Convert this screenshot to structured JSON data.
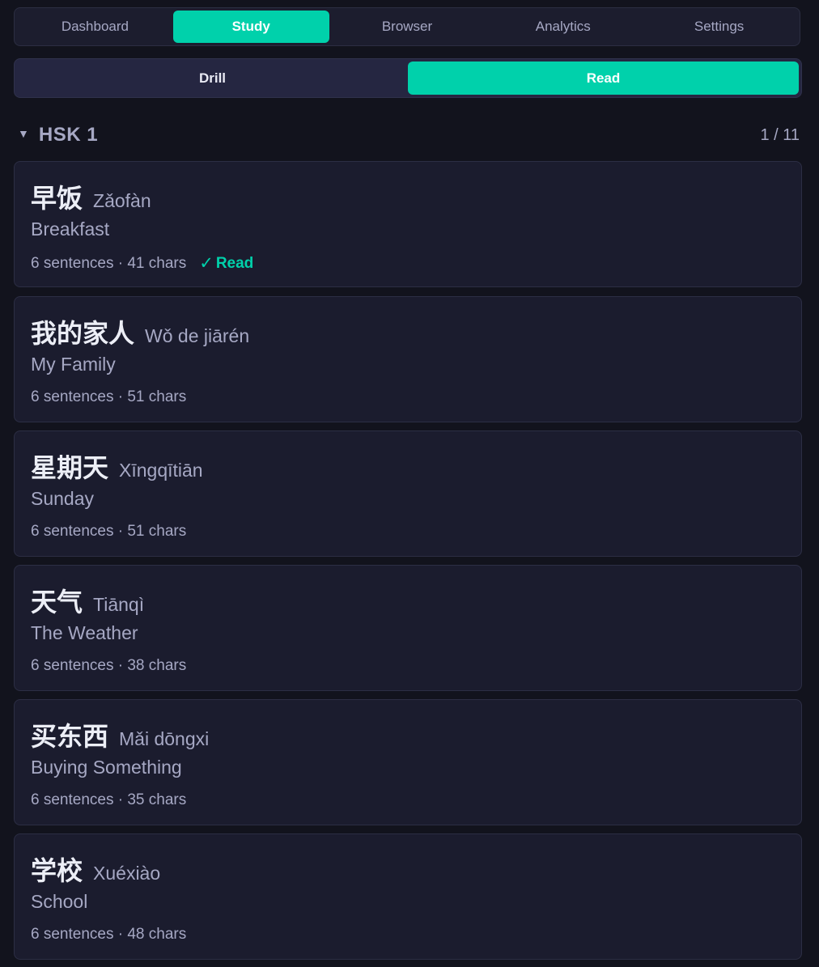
{
  "nav": {
    "tabs": [
      {
        "label": "Dashboard"
      },
      {
        "label": "Study"
      },
      {
        "label": "Browser"
      },
      {
        "label": "Analytics"
      },
      {
        "label": "Settings"
      }
    ],
    "active_tab": "Study"
  },
  "mode": {
    "tabs": [
      {
        "label": "Drill"
      },
      {
        "label": "Read"
      }
    ],
    "active": "Read"
  },
  "section": {
    "caret": "▼",
    "title": "HSK 1",
    "count": "1 / 11"
  },
  "lessons": [
    {
      "hanzi": "早饭",
      "pinyin": "Zǎofàn",
      "english": "Breakfast",
      "meta": "6 sentences · 41 chars",
      "read": true,
      "read_label": "Read",
      "check": "✓"
    },
    {
      "hanzi": "我的家人",
      "pinyin": "Wǒ de jiārén",
      "english": "My Family",
      "meta": "6 sentences · 51 chars",
      "read": false
    },
    {
      "hanzi": "星期天",
      "pinyin": "Xīngqītiān",
      "english": "Sunday",
      "meta": "6 sentences · 51 chars",
      "read": false
    },
    {
      "hanzi": "天气",
      "pinyin": "Tiānqì",
      "english": "The Weather",
      "meta": "6 sentences · 38 chars",
      "read": false
    },
    {
      "hanzi": "买东西",
      "pinyin": "Mǎi dōngxi",
      "english": "Buying Something",
      "meta": "6 sentences · 35 chars",
      "read": false
    },
    {
      "hanzi": "学校",
      "pinyin": "Xuéxiào",
      "english": "School",
      "meta": "6 sentences · 48 chars",
      "read": false
    }
  ],
  "colors": {
    "accent": "#00d1ab",
    "background": "#12131d",
    "card": "#1b1c2e",
    "muted_text": "#a6a8c4"
  }
}
